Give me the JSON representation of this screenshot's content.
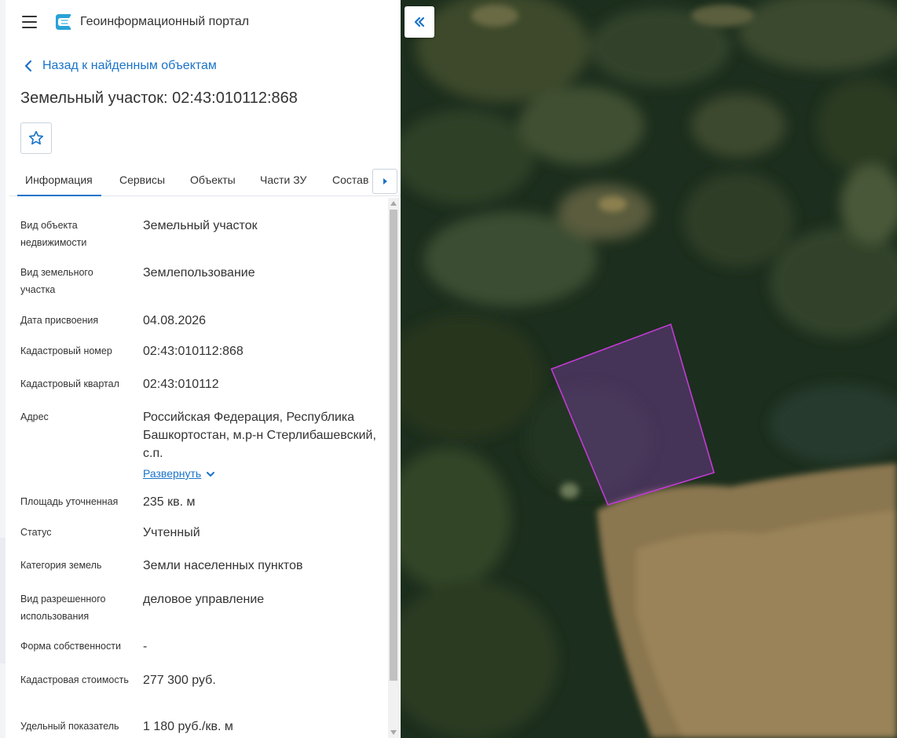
{
  "header": {
    "app_title": "Геоинформационный портал",
    "menu_icon": "hamburger-icon",
    "logo_icon": "portal-logo"
  },
  "nav": {
    "back_label": "Назад к найденным объектам"
  },
  "object": {
    "title": "Земельный участок: 02:43:010112:868"
  },
  "tabs": [
    {
      "label": "Информация",
      "active": true
    },
    {
      "label": "Сервисы",
      "active": false
    },
    {
      "label": "Объекты",
      "active": false
    },
    {
      "label": "Части ЗУ",
      "active": false
    },
    {
      "label": "Состав",
      "active": false
    }
  ],
  "info": {
    "rows": [
      {
        "label": "Вид объекта недвижимости",
        "value": "Земельный участок"
      },
      {
        "label": "Вид земельного участка",
        "value": "Землепользование"
      },
      {
        "label": "Дата присвоения",
        "value": "04.08.2026"
      },
      {
        "label": "Кадастровый номер",
        "value": "02:43:010112:868"
      },
      {
        "label": "Кадастровый квартал",
        "value": "02:43:010112"
      },
      {
        "label": "Адрес",
        "value": "Российская Федерация, Республика Башкортостан, м.р-н Стерлибашевский, с.п."
      },
      {
        "label": "Площадь уточненная",
        "value": "235 кв. м"
      },
      {
        "label": "Статус",
        "value": "Учтенный"
      },
      {
        "label": "Категория земель",
        "value": "Земли населенных пунктов"
      },
      {
        "label": "Вид разрешенного использования",
        "value": "деловое управление"
      },
      {
        "label": "Форма собственности",
        "value": "-"
      },
      {
        "label": "Кадастровая стоимость",
        "value": "277 300 руб."
      },
      {
        "label": "Удельный показатель",
        "value": "1 180 руб./кв. м"
      }
    ],
    "expand_label": "Развернуть"
  },
  "colors": {
    "accent": "#1a73c9",
    "parcel_outline": "#c23ad6",
    "text": "#333333"
  }
}
